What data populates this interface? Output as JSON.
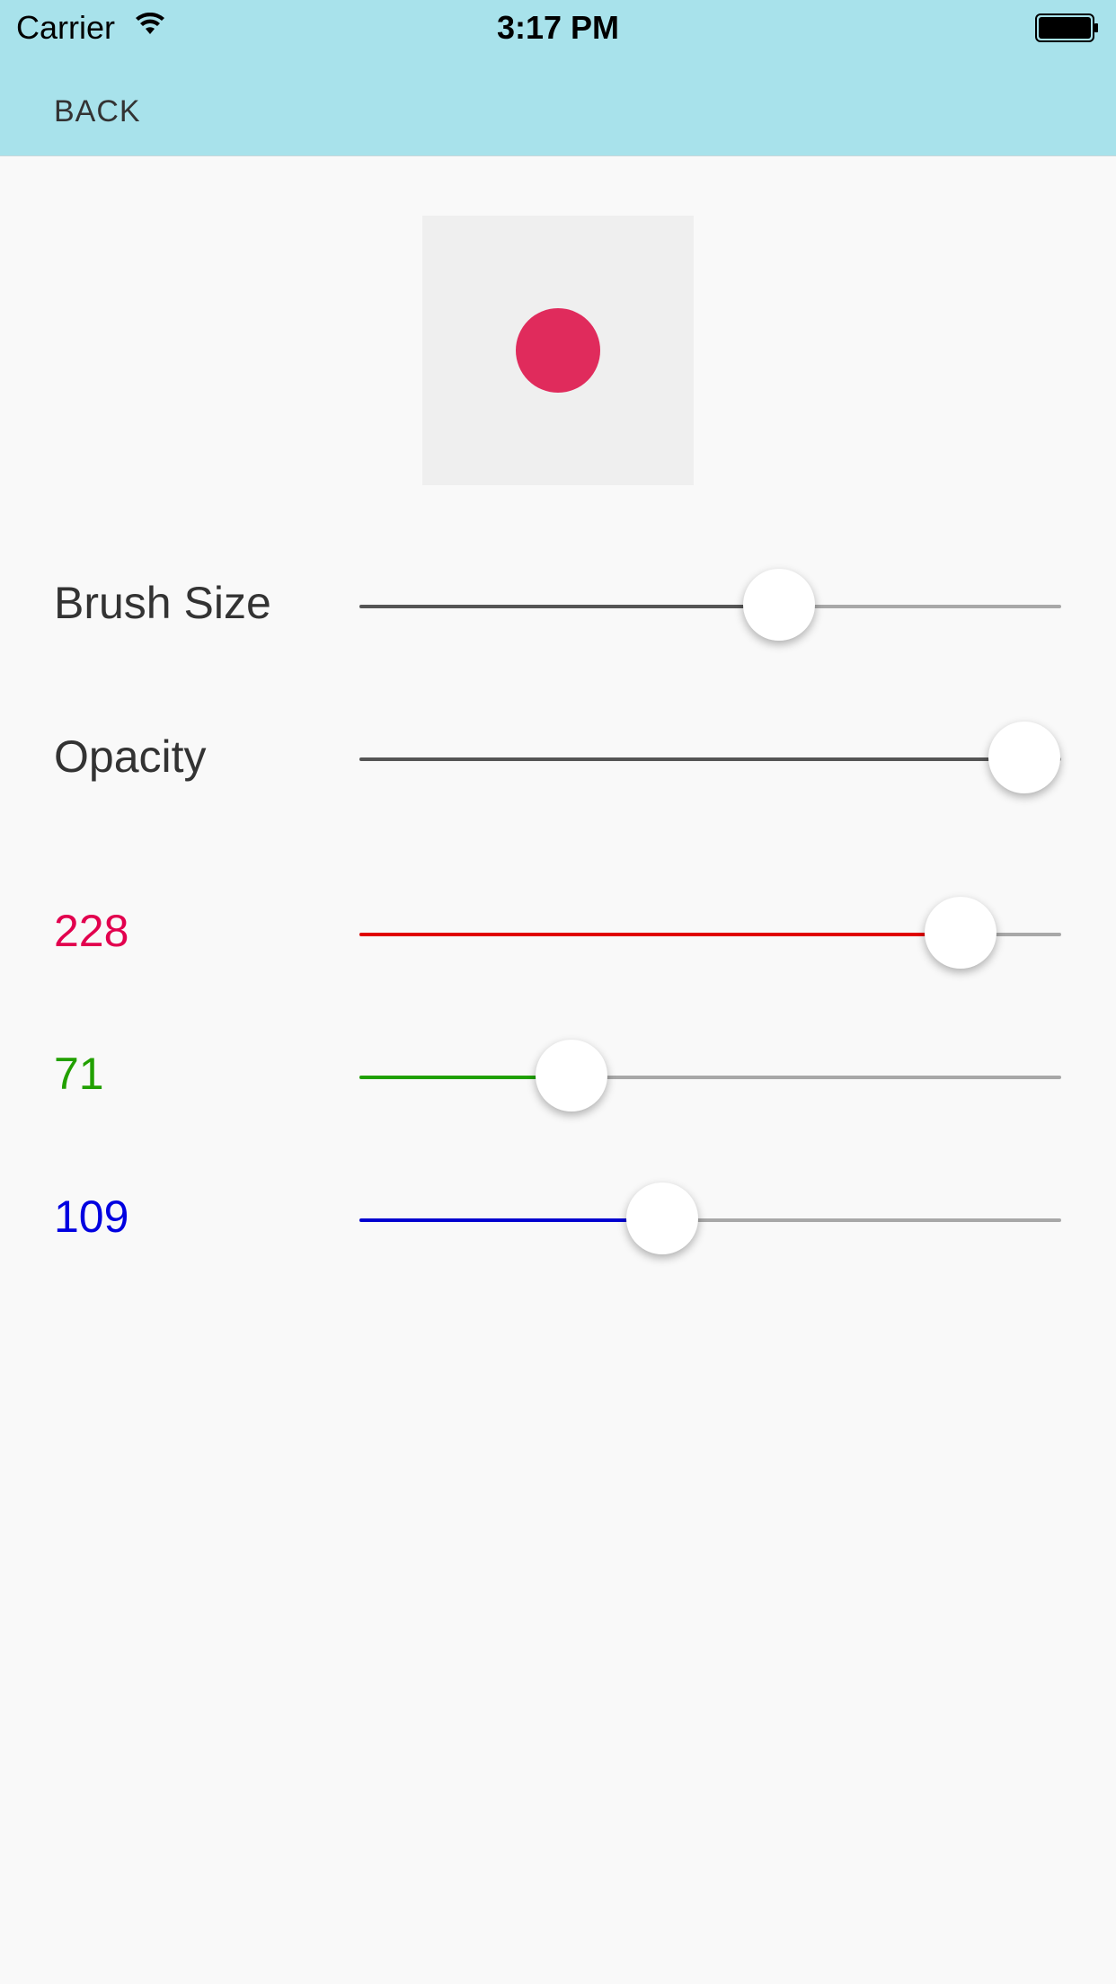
{
  "status_bar": {
    "carrier": "Carrier",
    "time": "3:17 PM",
    "icons": [
      "wifi-icon",
      "battery-icon"
    ]
  },
  "nav": {
    "back_label": "BACK",
    "background": "#a8e2eb"
  },
  "preview": {
    "color": "#e02b5c",
    "box_color": "#efefef"
  },
  "brush_size": {
    "label": "Brush Size",
    "fraction": 0.598,
    "fill_color": "#555555"
  },
  "opacity": {
    "label": "Opacity",
    "fraction": 0.947,
    "fill_color": "#555555"
  },
  "red": {
    "label": "228",
    "fraction": 0.856,
    "color": "#e2004e",
    "fill_color": "#e00000"
  },
  "green": {
    "label": "71",
    "fraction": 0.302,
    "color": "#22a000",
    "fill_color": "#20a000"
  },
  "blue": {
    "label": "109",
    "fraction": 0.432,
    "color": "#0000e0",
    "fill_color": "#0000d0"
  }
}
